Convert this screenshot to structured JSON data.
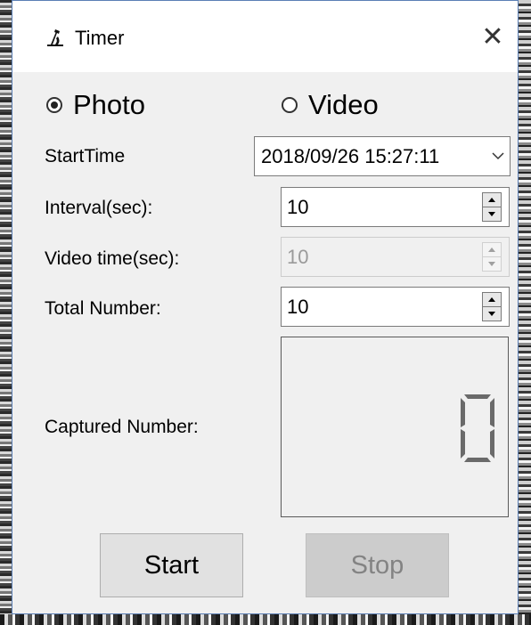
{
  "window": {
    "title": "Timer",
    "close_glyph": "✕",
    "app_icon": "microscope-icon",
    "border_color": "#5b7fb5"
  },
  "mode": {
    "options": [
      {
        "label": "Photo",
        "selected": true
      },
      {
        "label": "Video",
        "selected": false
      }
    ]
  },
  "fields": {
    "start_time": {
      "label": "StartTime",
      "value": "2018/09/26 15:27:11"
    },
    "interval": {
      "label": "Interval(sec):",
      "value": "10",
      "enabled": true
    },
    "video_time": {
      "label": "Video time(sec):",
      "value": "10",
      "enabled": false
    },
    "total_number": {
      "label": "Total Number:",
      "value": "10",
      "enabled": true
    },
    "captured_number": {
      "label": "Captured Number:",
      "value": "0"
    }
  },
  "buttons": {
    "start": {
      "label": "Start",
      "enabled": true
    },
    "stop": {
      "label": "Stop",
      "enabled": false
    }
  }
}
